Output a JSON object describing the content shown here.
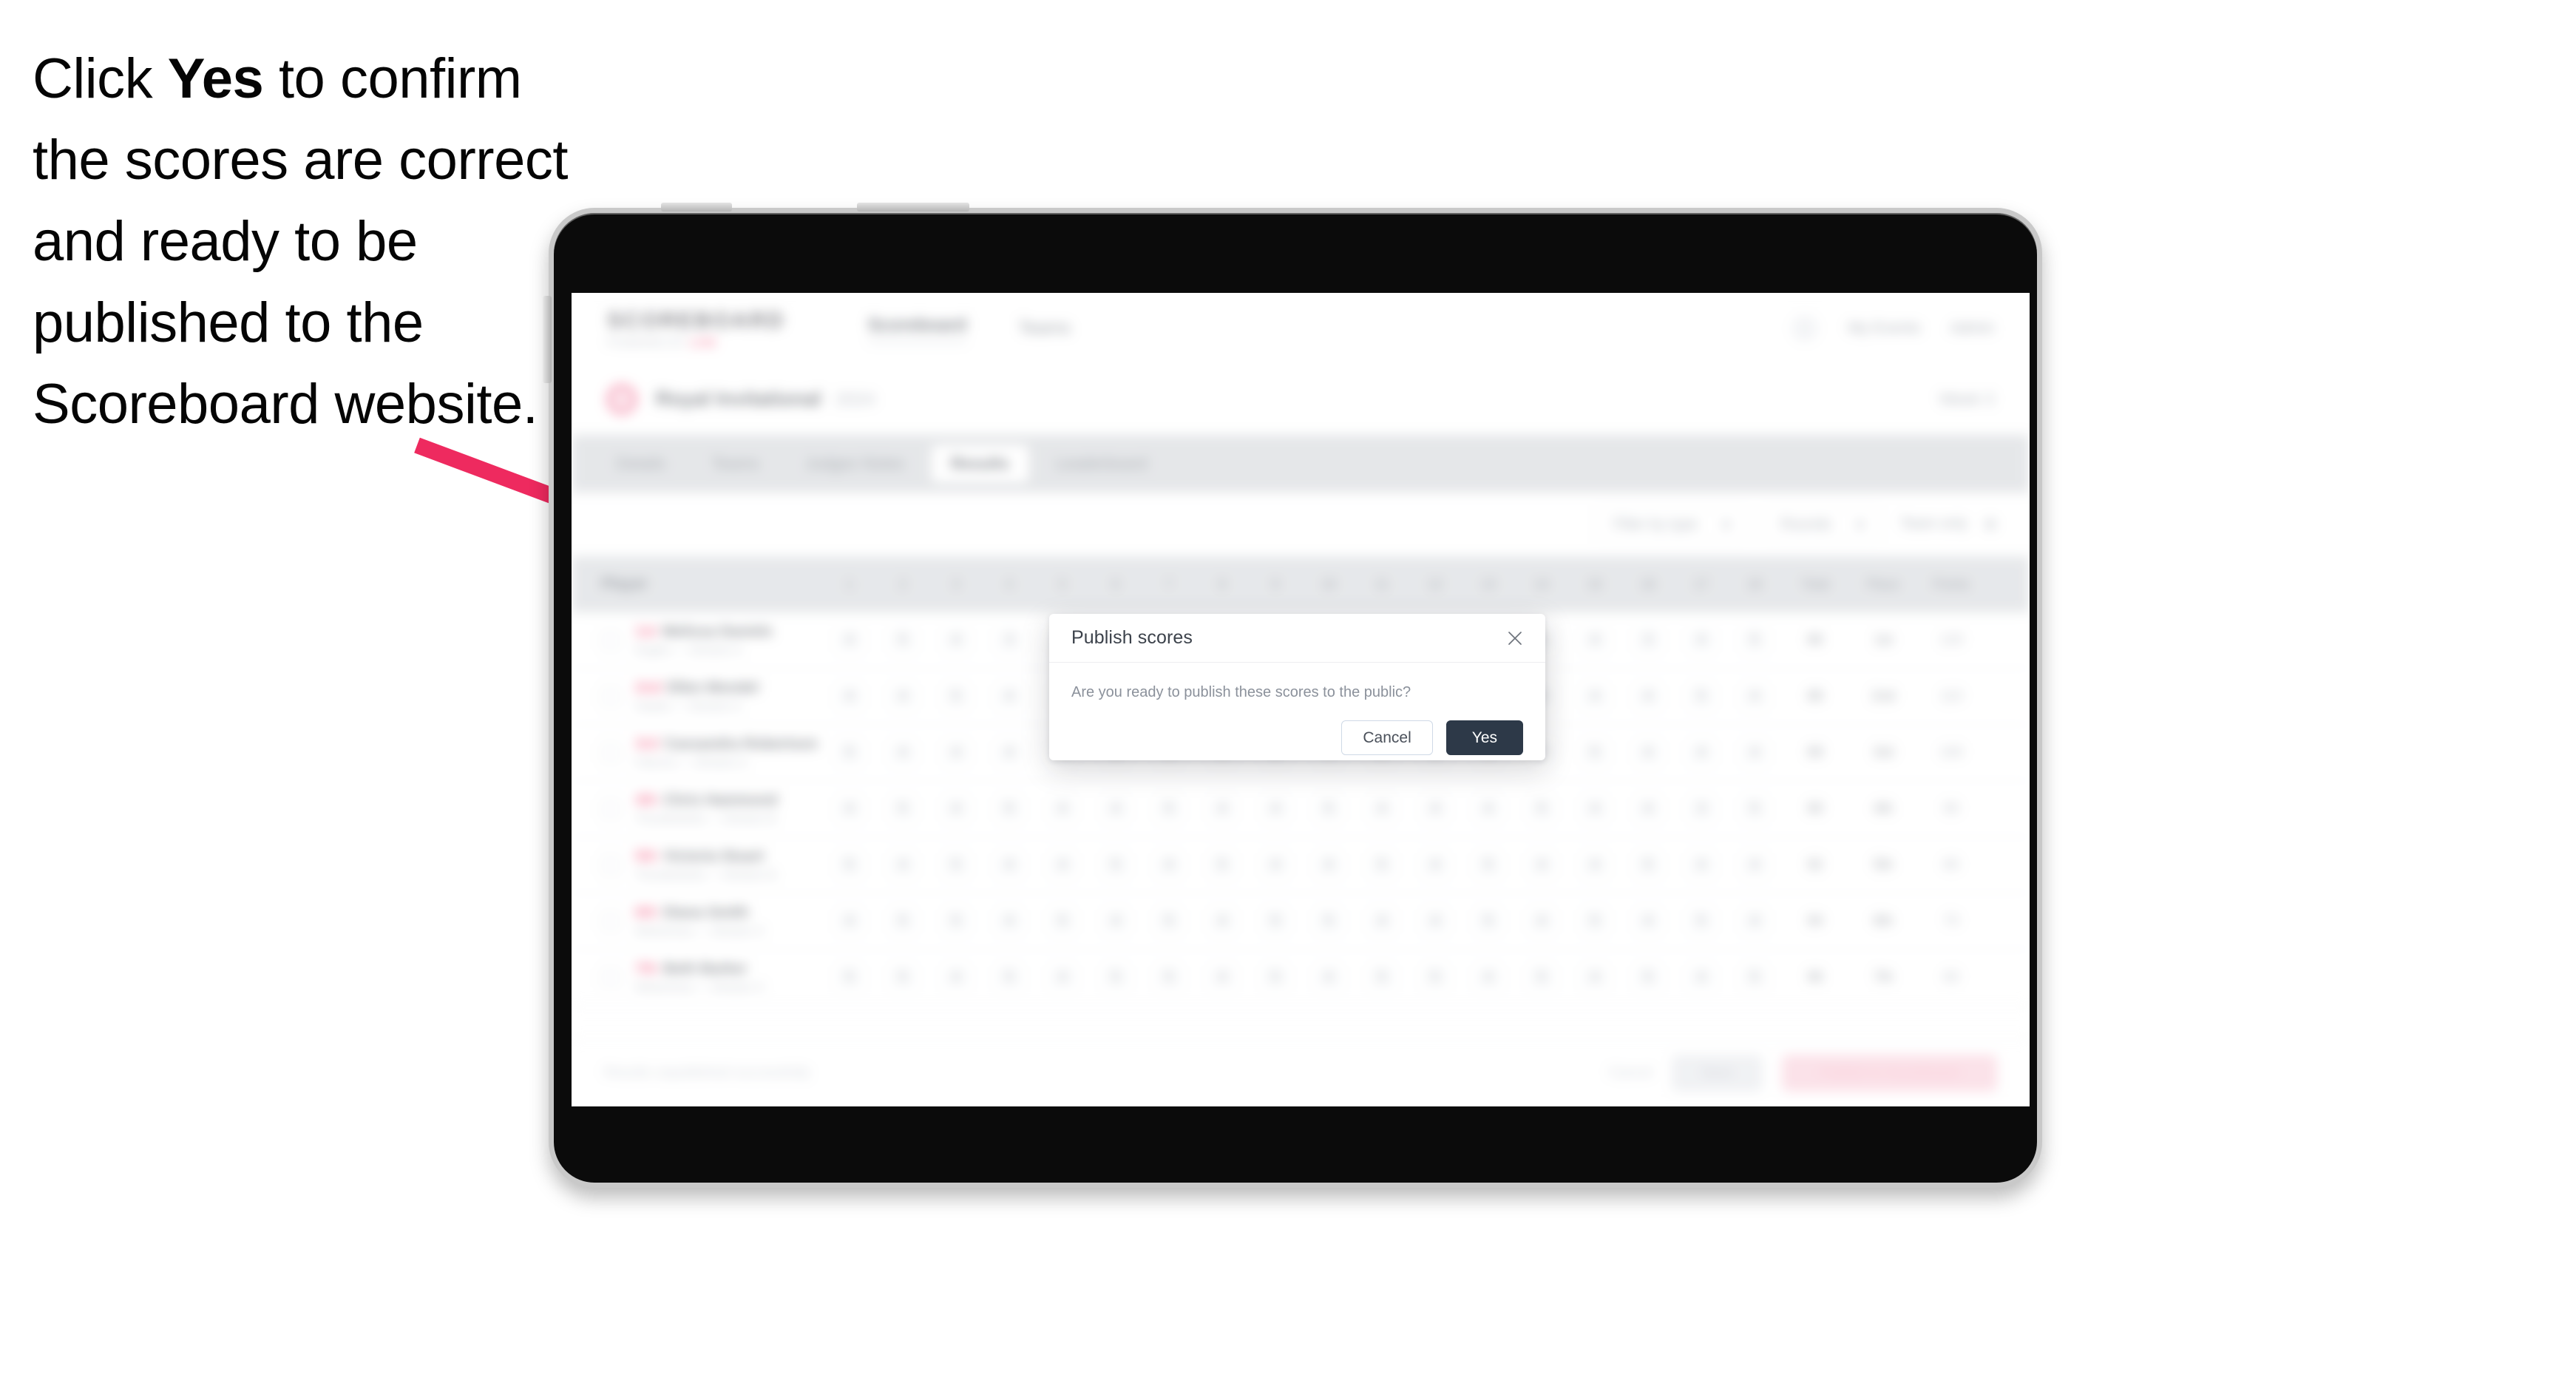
{
  "instruction": {
    "before": "Click ",
    "emphasis": "Yes",
    "after": " to confirm the scores are correct and ready to be published to the Scoreboard website."
  },
  "colors": {
    "arrow": "#ee2a5f",
    "accent_pink": "#ef2b5e",
    "primary_dark": "#2d3948",
    "device_bezel": "#c9c9c9",
    "device_body": "#0b0b0b"
  },
  "modal": {
    "title": "Publish scores",
    "message": "Are you ready to publish these scores to the public?",
    "close_icon": "close-icon",
    "cancel_label": "Cancel",
    "confirm_label": "Yes"
  },
  "app": {
    "brand_name": "SCOREBOARD",
    "brand_sub": "POWERED BY",
    "brand_sub_accent": "LIVE",
    "topnav": [
      "Scoreboard",
      "Teams"
    ],
    "top_right": [
      "My Events",
      "Admin"
    ],
    "subhead_title": "Royal Invitational",
    "subhead_meta": "2024",
    "subhead_right": "Week 3",
    "tabs": [
      "Details",
      "Teams",
      "Judges Notes",
      "Results",
      "Leaderboard"
    ],
    "active_tab": "Results",
    "filters": [
      "Filter by type",
      "Rounds",
      "Team only"
    ],
    "table": {
      "headers": [
        "Player",
        "1",
        "2",
        "3",
        "4",
        "5",
        "6",
        "7",
        "8",
        "9",
        "10",
        "11",
        "12",
        "13",
        "14",
        "15",
        "16",
        "17",
        "18",
        "Total",
        "Place",
        "Points"
      ],
      "rows": [
        {
          "rank": "1st",
          "name": "Melissa Daniels",
          "team": "Eagles — Division A",
          "scores": [
            "4",
            "5",
            "4",
            "3",
            "5",
            "4",
            "4",
            "3",
            "5",
            "4",
            "4",
            "3",
            "4",
            "5",
            "4",
            "3",
            "4",
            "5"
          ],
          "total": "86",
          "place": "1st",
          "points": "120"
        },
        {
          "rank": "2nd",
          "name": "Ellen Mondel",
          "team": "Hawks — Division A",
          "scores": [
            "4",
            "4",
            "5",
            "4",
            "4",
            "4",
            "3",
            "5",
            "4",
            "4",
            "5",
            "4",
            "3",
            "4",
            "4",
            "4",
            "5",
            "4"
          ],
          "total": "88",
          "place": "2nd",
          "points": "110"
        },
        {
          "rank": "3rd",
          "name": "Cassandra Robertson",
          "team": "Falcons — Division A",
          "scores": [
            "5",
            "4",
            "4",
            "4",
            "5",
            "3",
            "4",
            "4",
            "5",
            "4",
            "4",
            "5",
            "4",
            "3",
            "5",
            "4",
            "4",
            "4"
          ],
          "total": "89",
          "place": "3rd",
          "points": "100"
        },
        {
          "rank": "4th",
          "name": "Chris Hammond",
          "team": "Thunderbirds — Division B",
          "scores": [
            "4",
            "5",
            "4",
            "5",
            "4",
            "4",
            "5",
            "4",
            "4",
            "5",
            "4",
            "4",
            "4",
            "5",
            "4",
            "4",
            "3",
            "5"
          ],
          "total": "90",
          "place": "4th",
          "points": "90"
        },
        {
          "rank": "5th",
          "name": "Victoria Stuart",
          "team": "Thunderbirds — Division B",
          "scores": [
            "5",
            "4",
            "5",
            "4",
            "4",
            "5",
            "4",
            "5",
            "4",
            "4",
            "5",
            "4",
            "5",
            "4",
            "4",
            "5",
            "4",
            "4"
          ],
          "total": "92",
          "place": "5th",
          "points": "80"
        },
        {
          "rank": "6th",
          "name": "Diana Smith",
          "team": "Wolverines — Division C",
          "scores": [
            "4",
            "5",
            "5",
            "4",
            "5",
            "4",
            "5",
            "4",
            "5",
            "5",
            "4",
            "4",
            "5",
            "4",
            "5",
            "4",
            "5",
            "4"
          ],
          "total": "94",
          "place": "6th",
          "points": "70"
        },
        {
          "rank": "7th",
          "name": "Beth Barker",
          "team": "Wolverines — Division C",
          "scores": [
            "5",
            "5",
            "4",
            "5",
            "4",
            "5",
            "5",
            "4",
            "5",
            "4",
            "5",
            "5",
            "4",
            "5",
            "4",
            "5",
            "4",
            "5"
          ],
          "total": "96",
          "place": "7th",
          "points": "60"
        }
      ]
    },
    "footer_note": "Results unpublished successfully",
    "footer_actions": {
      "link": "Cancel",
      "secondary": "Save",
      "primary": "Publish to Scoreboard"
    }
  }
}
